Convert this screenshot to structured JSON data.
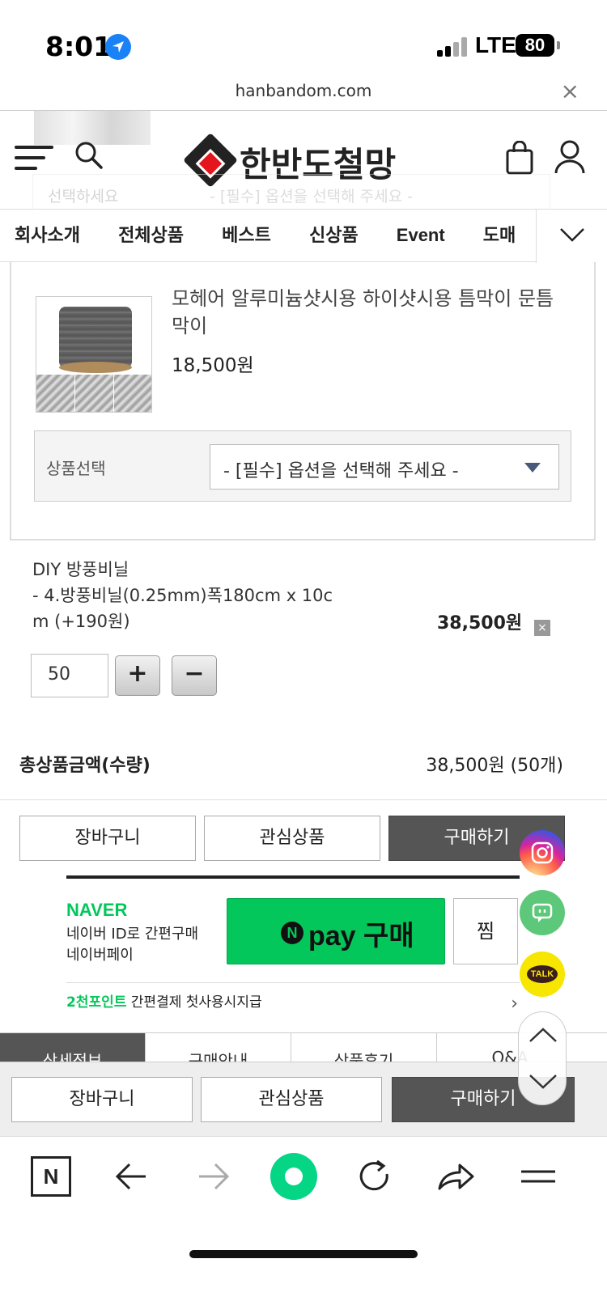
{
  "status": {
    "time": "8:01",
    "network": "LTE",
    "battery": "80"
  },
  "browser": {
    "url": "hanbandom.com",
    "close": "×"
  },
  "header": {
    "logo_text": "한반도철망"
  },
  "ghost": {
    "label": "선택하세요",
    "select": "- [필수] 옵션을 선택해 주세요 -"
  },
  "nav": {
    "items": [
      "회사소개",
      "전체상품",
      "베스트",
      "신상품",
      "Event",
      "도매"
    ]
  },
  "product": {
    "name": "모헤어 알루미늄샷시용 하이샷시용 틈막이 문틈막이",
    "price": "18,500원",
    "option_label": "상품선택",
    "option_placeholder": "- [필수] 옵션을 선택해 주세요 -"
  },
  "selected": {
    "name": "DIY 방풍비닐",
    "detail1": "- 4.방풍비닐(0.25mm)폭180cm x 10c",
    "detail2": "m (+190원)",
    "price": "38,500원",
    "remove": "×",
    "quantity": "50",
    "plus": "+",
    "minus": "−"
  },
  "total": {
    "label": "총상품금액(수량)",
    "value": "38,500원 (50개)"
  },
  "actions": {
    "cart": "장바구니",
    "wish": "관심상품",
    "buy": "구매하기"
  },
  "naver": {
    "brand": "NAVER",
    "sub1": "네이버 ID로 간편구매",
    "sub2": "네이버페이",
    "n": "N",
    "pay": "pay 구매",
    "zzim": "찜",
    "promo_green": "2천포인트",
    "promo_rest": " 간편결제 첫사용시지급",
    "arrow": "›"
  },
  "floating": {
    "talk": "TALK"
  },
  "detail_tabs": [
    "상세정보",
    "구매안내",
    "상품후기",
    "Q&A"
  ],
  "sticky": {
    "cart": "장바구니",
    "wish": "관심상품",
    "buy": "구매하기"
  },
  "toolbar": {
    "n": "N"
  }
}
